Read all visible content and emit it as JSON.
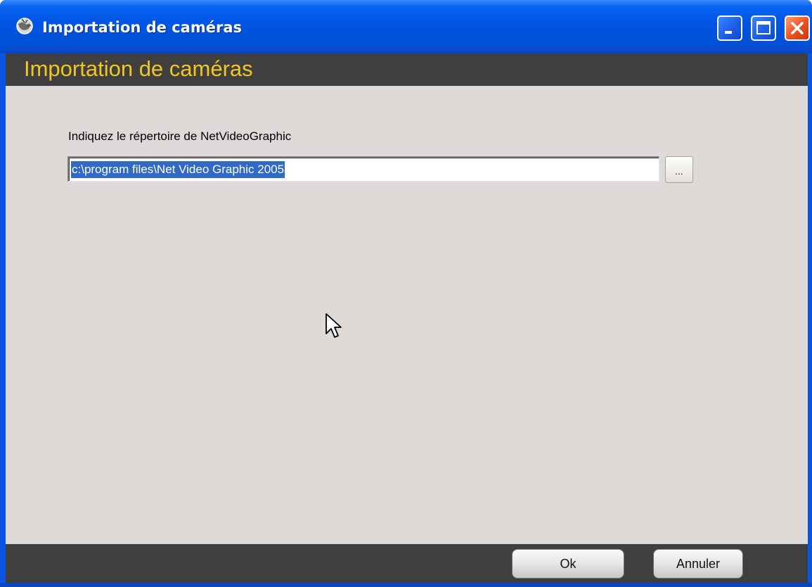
{
  "window": {
    "title": "Importation de caméras",
    "controls": {
      "minimize_icon": "minimize-icon",
      "maximize_icon": "maximize-icon",
      "close_icon": "close-icon"
    }
  },
  "header": {
    "title": "Importation de caméras"
  },
  "form": {
    "label": "Indiquez le répertoire de NetVideoGraphic",
    "path_value": "c:\\program files\\Net Video Graphic 2005",
    "browse_label": "..."
  },
  "footer": {
    "ok_label": "Ok",
    "cancel_label": "Annuler"
  },
  "colors": {
    "header_text": "#f0c81e",
    "band": "#3f3f3f",
    "client_bg": "#dddad7",
    "titlebar": "#0054e3",
    "selection": "#316ac5"
  }
}
